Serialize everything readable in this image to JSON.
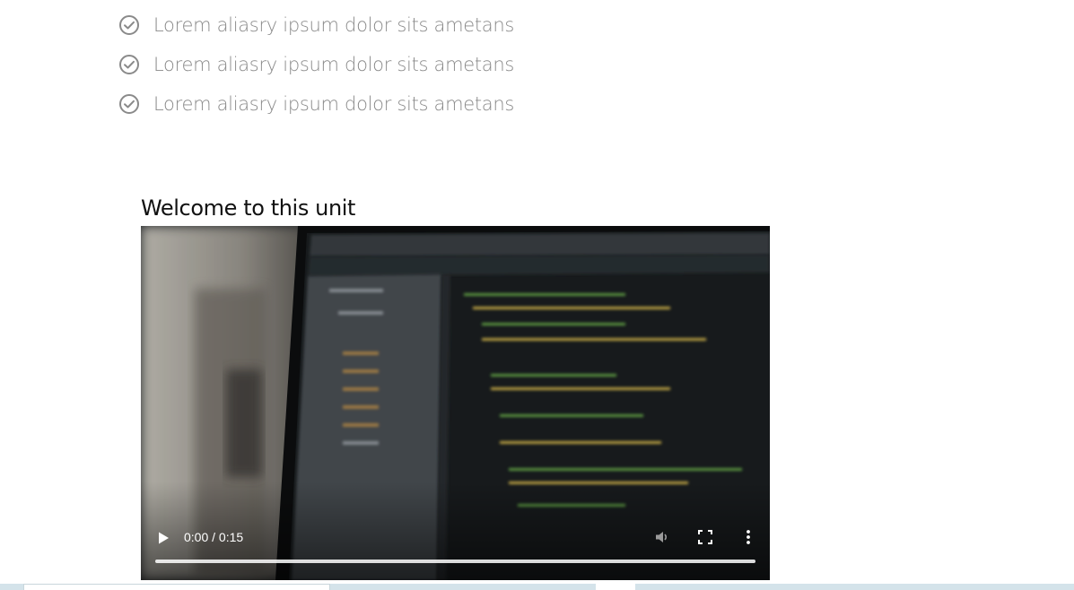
{
  "checklist": {
    "items": [
      {
        "label": "Lorem aliasry ipsum dolor sits ametans",
        "icon": "check-circle-icon"
      },
      {
        "label": "Lorem aliasry ipsum dolor sits ametans",
        "icon": "check-circle-icon"
      },
      {
        "label": "Lorem aliasry ipsum dolor sits ametans",
        "icon": "check-circle-icon"
      }
    ]
  },
  "unit": {
    "title": "Welcome to this unit"
  },
  "video": {
    "time_display": "0:00 / 0:15",
    "progress": 0,
    "controls": {
      "play_icon": "play-icon",
      "volume_icon": "volume-icon",
      "fullscreen_icon": "fullscreen-icon",
      "menu_icon": "more-vert-icon"
    }
  },
  "colors": {
    "check_icon": "#8a8a8a",
    "list_text": "#8a8a8a",
    "title_text": "#111111",
    "bottom_strip": "#d4e3ea"
  }
}
